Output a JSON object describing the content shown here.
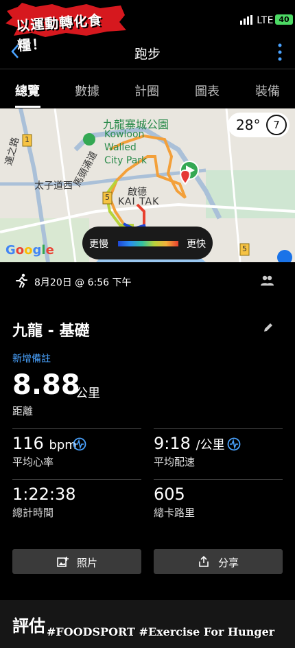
{
  "status_bar": {
    "logo_text": "以運動轉化食糧！",
    "carrier": "LTE",
    "battery": "40"
  },
  "nav": {
    "title": "跑步"
  },
  "tabs": [
    {
      "label": "總覽"
    },
    {
      "label": "數據"
    },
    {
      "label": "計圈"
    },
    {
      "label": "圖表"
    },
    {
      "label": "裝備"
    }
  ],
  "map": {
    "labels": {
      "park_zh": "九龍寨城公園",
      "park_en_1": "Kowloon",
      "park_en_2": "Walled",
      "park_en_3": "City Park",
      "road1": "太子道西",
      "road2": "馬頭涌道",
      "road3": "達之路",
      "district_zh": "啟德",
      "district_en": "KAI TAK",
      "route_5a": "5",
      "route_5b": "5",
      "route_1": "1"
    },
    "temperature": "28°",
    "wind_level": "7",
    "legend": {
      "slow": "更慢",
      "fast": "更快"
    },
    "attribution": "Google",
    "colors": {
      "route_slow": "#1f47d6",
      "route_mid": "#b6d33a",
      "route_fast": "#e8402e",
      "route_orange": "#f3a03a",
      "start_pin": "#34a853",
      "end_pin": "#e53935"
    }
  },
  "activity": {
    "date": "8月20日 @ 6:56 下午",
    "title": "九龍 - 基礎",
    "add_note": "新增備註",
    "distance": {
      "value": "8.88",
      "unit": "公里",
      "label": "距離"
    },
    "stats": [
      {
        "value": "116",
        "unit": "bpm",
        "label": "平均心率"
      },
      {
        "value": "9:18",
        "unit": "/公里",
        "label": "平均配速"
      },
      {
        "value": "1:22:38",
        "unit": "",
        "label": "總計時間"
      },
      {
        "value": "605",
        "unit": "",
        "label": "總卡路里"
      }
    ],
    "buttons": {
      "photos": "照片",
      "share": "分享"
    }
  },
  "evaluation": {
    "title": "評估"
  },
  "watermark": "#FOODSPORT #Exercise For Hunger",
  "accent": "#4aa3ff"
}
